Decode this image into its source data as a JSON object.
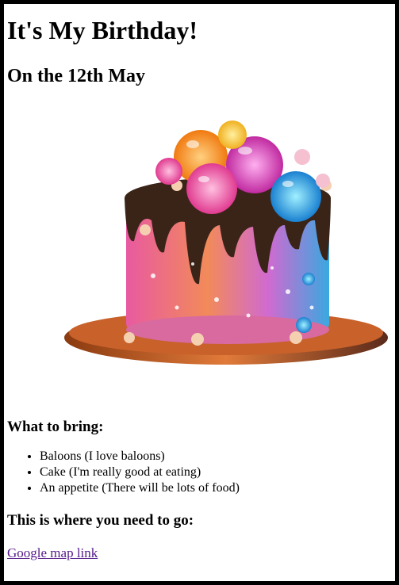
{
  "page": {
    "title": "It's My Birthday!",
    "date": "On the 12th May",
    "bring_heading": "What to bring:",
    "bring_items": [
      "Baloons (I love baloons)",
      "Cake (I'm really good at eating)",
      "An appetite (There will be lots of food)"
    ],
    "where_heading": "This is where you need to go:",
    "map_link": "Google map link"
  },
  "colors": {
    "link": "#551a8b",
    "border": "#000000"
  }
}
